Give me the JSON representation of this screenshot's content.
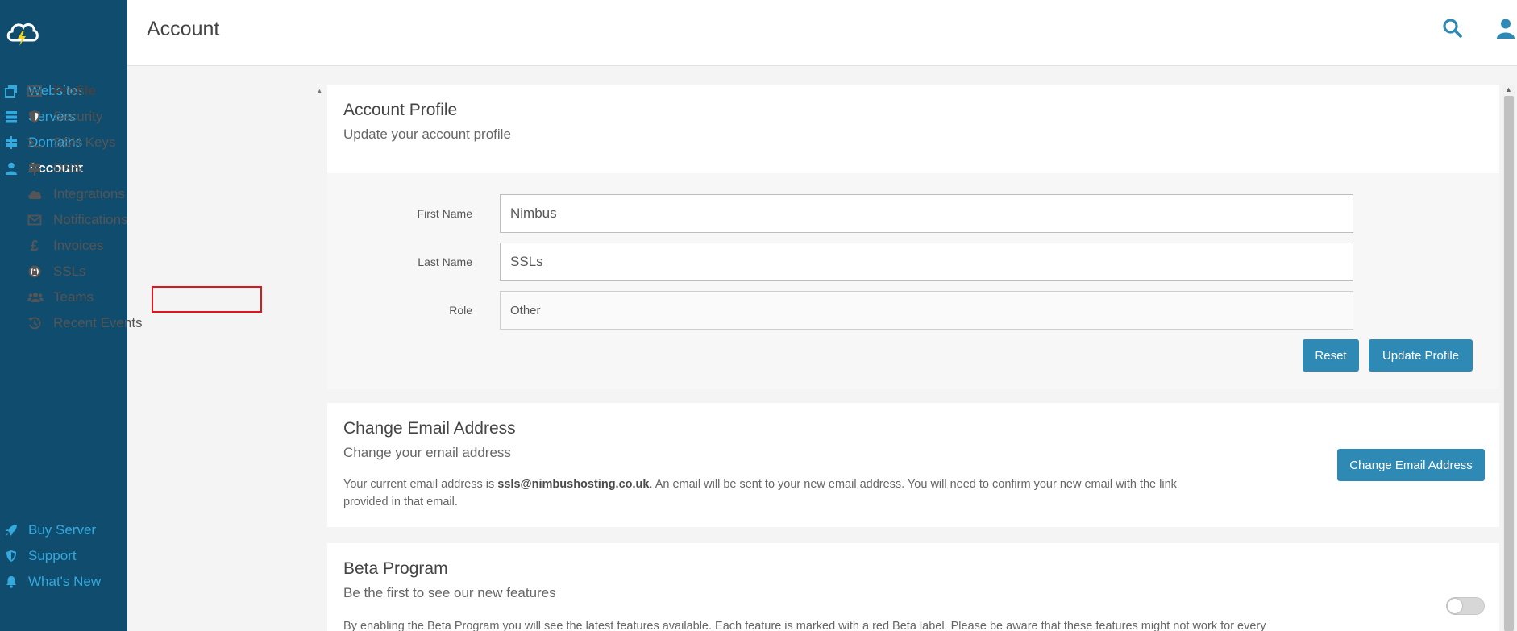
{
  "header": {
    "title": "Account"
  },
  "sidebar": {
    "items": [
      {
        "label": "Websites",
        "icon": "websites-icon"
      },
      {
        "label": "Servers",
        "icon": "servers-icon"
      },
      {
        "label": "Domains",
        "icon": "domains-icon"
      },
      {
        "label": "Account",
        "icon": "user-icon",
        "active": true
      }
    ],
    "bottom_items": [
      {
        "label": "Buy Server",
        "icon": "rocket-icon"
      },
      {
        "label": "Support",
        "icon": "shield-icon"
      },
      {
        "label": "What's New",
        "icon": "bell-icon"
      }
    ]
  },
  "subnav": {
    "items": [
      {
        "label": "Profile",
        "icon": "id-card-icon",
        "active": true
      },
      {
        "label": "Security",
        "icon": "shield-icon"
      },
      {
        "label": "SSH Keys",
        "icon": "terminal-icon"
      },
      {
        "label": "DNS",
        "icon": "signpost-icon"
      },
      {
        "label": "Integrations",
        "icon": "cloud-icon"
      },
      {
        "label": "Notifications",
        "icon": "envelope-icon"
      },
      {
        "label": "Invoices",
        "icon": "pound-icon"
      },
      {
        "label": "SSLs",
        "icon": "certificate-icon"
      },
      {
        "label": "Teams",
        "icon": "users-icon"
      },
      {
        "label": "Recent Events",
        "icon": "history-icon"
      }
    ]
  },
  "profile": {
    "title": "Account Profile",
    "subtitle": "Update your account profile",
    "first_name_label": "First Name",
    "first_name_value": "Nimbus",
    "last_name_label": "Last Name",
    "last_name_value": "SSLs",
    "role_label": "Role",
    "role_value": "Other",
    "reset_label": "Reset",
    "update_label": "Update Profile"
  },
  "email": {
    "title": "Change Email Address",
    "subtitle": "Change your email address",
    "text_before": "Your current email address is ",
    "address": "ssls@nimbushosting.co.uk",
    "text_after": ". An email will be sent to your new email address. You will need to confirm your new email with the link provided in that email.",
    "button_label": "Change Email Address"
  },
  "beta": {
    "title": "Beta Program",
    "subtitle": "Be the first to see our new features",
    "text": "By enabling the Beta Program you will see the latest features available. Each feature is marked with a red Beta label. Please be aware that these features might not work for every",
    "enabled": false
  },
  "colors": {
    "sidebar_bg": "#0f4c6e",
    "accent": "#35a9dd",
    "button": "#2e89b5",
    "highlight": "#e0151c"
  }
}
